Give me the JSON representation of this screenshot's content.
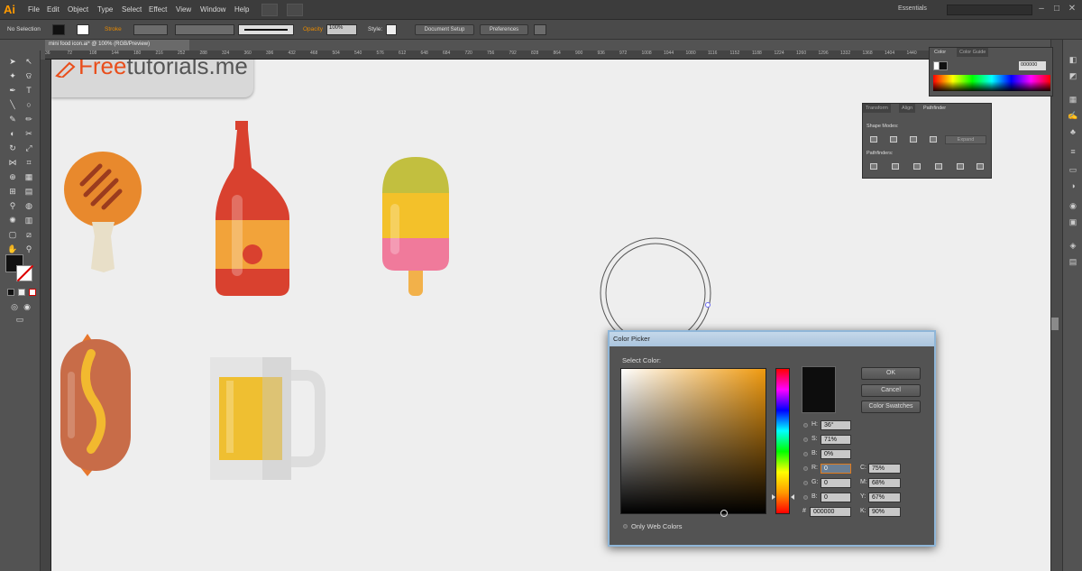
{
  "app": {
    "logo": "Ai"
  },
  "menu": [
    "File",
    "Edit",
    "Object",
    "Type",
    "Select",
    "Effect",
    "View",
    "Window",
    "Help"
  ],
  "workspace": "Essentials",
  "control": {
    "selection": "No Selection",
    "stroke": "Stroke",
    "opacity_label": "Opacity",
    "opacity_value": "100%",
    "style_label": "Style:",
    "doc_setup": "Document Setup",
    "preferences": "Preferences"
  },
  "document": {
    "tab": "mini food icon.ai* @ 100% (RGB/Preview)"
  },
  "ruler": [
    "36",
    "72",
    "108",
    "144",
    "180",
    "216",
    "252",
    "288",
    "324",
    "360",
    "396",
    "432",
    "468",
    "504",
    "540",
    "576",
    "612",
    "648",
    "684",
    "720",
    "756",
    "792",
    "828",
    "864",
    "900",
    "936",
    "972",
    "1008",
    "1044",
    "1080",
    "1116",
    "1152",
    "1188",
    "1224",
    "1260",
    "1296",
    "1332",
    "1368",
    "1404",
    "1440",
    "1476",
    "1512",
    "1548"
  ],
  "watermark": {
    "accent": "Free",
    "rest": "tutorials.me"
  },
  "color_panel": {
    "tabs": [
      "Color",
      "Color Guide"
    ],
    "hex": "000000"
  },
  "pathfinder_panel": {
    "tabs": [
      "Transform",
      "Align",
      "Pathfinder"
    ],
    "shape_modes": "Shape Modes:",
    "pathfinders": "Pathfinders:",
    "expand": "Expand"
  },
  "picker": {
    "title": "Color Picker",
    "select_color": "Select Color:",
    "ok": "OK",
    "cancel": "Cancel",
    "swatches": "Color Swatches",
    "H": "36°",
    "S": "71%",
    "B": "0%",
    "R": "0",
    "G": "0",
    "Bv": "0",
    "hex": "000000",
    "C": "75%",
    "M": "68%",
    "Y": "67%",
    "K": "90%",
    "web_only": "Only Web Colors"
  },
  "colors": {
    "accent": "#e88a00",
    "chicken": "#e8892d",
    "ketchup": "#d9412f",
    "label": "#f2a33a",
    "popsicle_top": "#c2bf3f",
    "popsicle_mid": "#f3c12a",
    "popsicle_bottom": "#f07a9b",
    "sausage": "#c86c48",
    "mustard": "#f2b92f",
    "beer": "#efbf31"
  }
}
